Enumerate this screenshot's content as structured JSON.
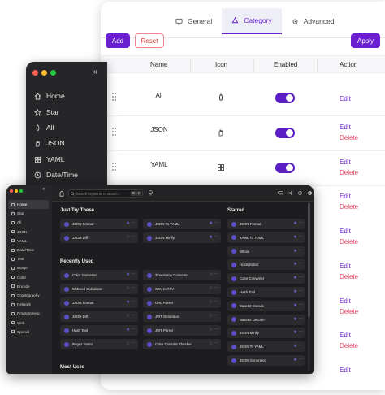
{
  "settings": {
    "tabs": [
      {
        "label": "General",
        "icon": "monitor-icon"
      },
      {
        "label": "Category",
        "icon": "shapes-icon"
      },
      {
        "label": "Advanced",
        "icon": "gear-icon"
      }
    ],
    "add_label": "Add",
    "reset_label": "Reset",
    "apply_label": "Apply",
    "columns": {
      "name": "Name",
      "icon": "Icon",
      "enabled": "Enabled",
      "action": "Action"
    },
    "rows": [
      {
        "name": "All",
        "icon": "rocket-icon",
        "enabled": true,
        "edit": "Edit"
      },
      {
        "name": "JSON",
        "icon": "hand-icon",
        "enabled": true,
        "edit": "Edit",
        "delete": "Delete"
      },
      {
        "name": "YAML",
        "icon": "grid-icon",
        "enabled": true,
        "edit": "Edit",
        "delete": "Delete"
      }
    ],
    "extra_actions": [
      {
        "edit": "Edit",
        "delete": "Delete"
      },
      {
        "edit": "Edit",
        "delete": "Delete"
      },
      {
        "edit": "Edit",
        "delete": "Delete"
      },
      {
        "edit": "Edit",
        "delete": "Delete"
      },
      {
        "edit": "Edit",
        "delete": "Delete"
      },
      {
        "edit": "Edit",
        "delete": "Delete"
      }
    ],
    "accent": "#6a1fd0",
    "danger": "#e0405a"
  },
  "dark_sidebar": {
    "items": [
      {
        "label": "Home",
        "icon": "home-icon"
      },
      {
        "label": "Star",
        "icon": "star-icon"
      },
      {
        "label": "All",
        "icon": "rocket-icon"
      },
      {
        "label": "JSON",
        "icon": "hand-icon"
      },
      {
        "label": "YAML",
        "icon": "grid-icon"
      },
      {
        "label": "Date/Time",
        "icon": "clock-icon"
      }
    ]
  },
  "app": {
    "sidebar": [
      "Home",
      "Star",
      "All",
      "JSON",
      "YAML",
      "Date/Time",
      "Text",
      "Image",
      "Color",
      "Encode",
      "Cryptography",
      "Network",
      "Programming",
      "Web",
      "Special"
    ],
    "search_placeholder": "Search keywords to search...",
    "search_keys": [
      "⌘",
      "K"
    ],
    "sections": {
      "just_try": "Just Try These",
      "starred": "Starred",
      "recent": "Recently Used",
      "most": "Most Used"
    },
    "just_try_cards": [
      {
        "label": "JSON Format",
        "starred": true
      },
      {
        "label": "JSON To YAML",
        "starred": true
      },
      {
        "label": "JSON Diff",
        "starred": false
      },
      {
        "label": "JSON Minify",
        "starred": true
      }
    ],
    "recent_cards": [
      {
        "label": "Color Converter",
        "starred": true
      },
      {
        "label": "Timestamp Converter",
        "starred": false
      },
      {
        "label": "Cfdseed Calculator",
        "starred": false
      },
      {
        "label": "CSV to TSV",
        "starred": false
      },
      {
        "label": "JSON Format",
        "starred": true
      },
      {
        "label": "URL Parser",
        "starred": false
      },
      {
        "label": "JSON Diff",
        "starred": false
      },
      {
        "label": "JWT Generator",
        "starred": false
      },
      {
        "label": "Hash Tool",
        "starred": true
      },
      {
        "label": "JWT Parser",
        "starred": false
      },
      {
        "label": "Regex Tester",
        "starred": false
      },
      {
        "label": "Color Contrast Checker",
        "starred": false
      }
    ],
    "starred_cards": [
      "JSON Format",
      "YAML To TOML",
      "Whois",
      "Hosts Editor",
      "Color Converter",
      "Hash Tool",
      "Base62 Encode",
      "Base62 Decode",
      "JSON Minify",
      "JSON To YAML",
      "JSON Generator"
    ]
  }
}
